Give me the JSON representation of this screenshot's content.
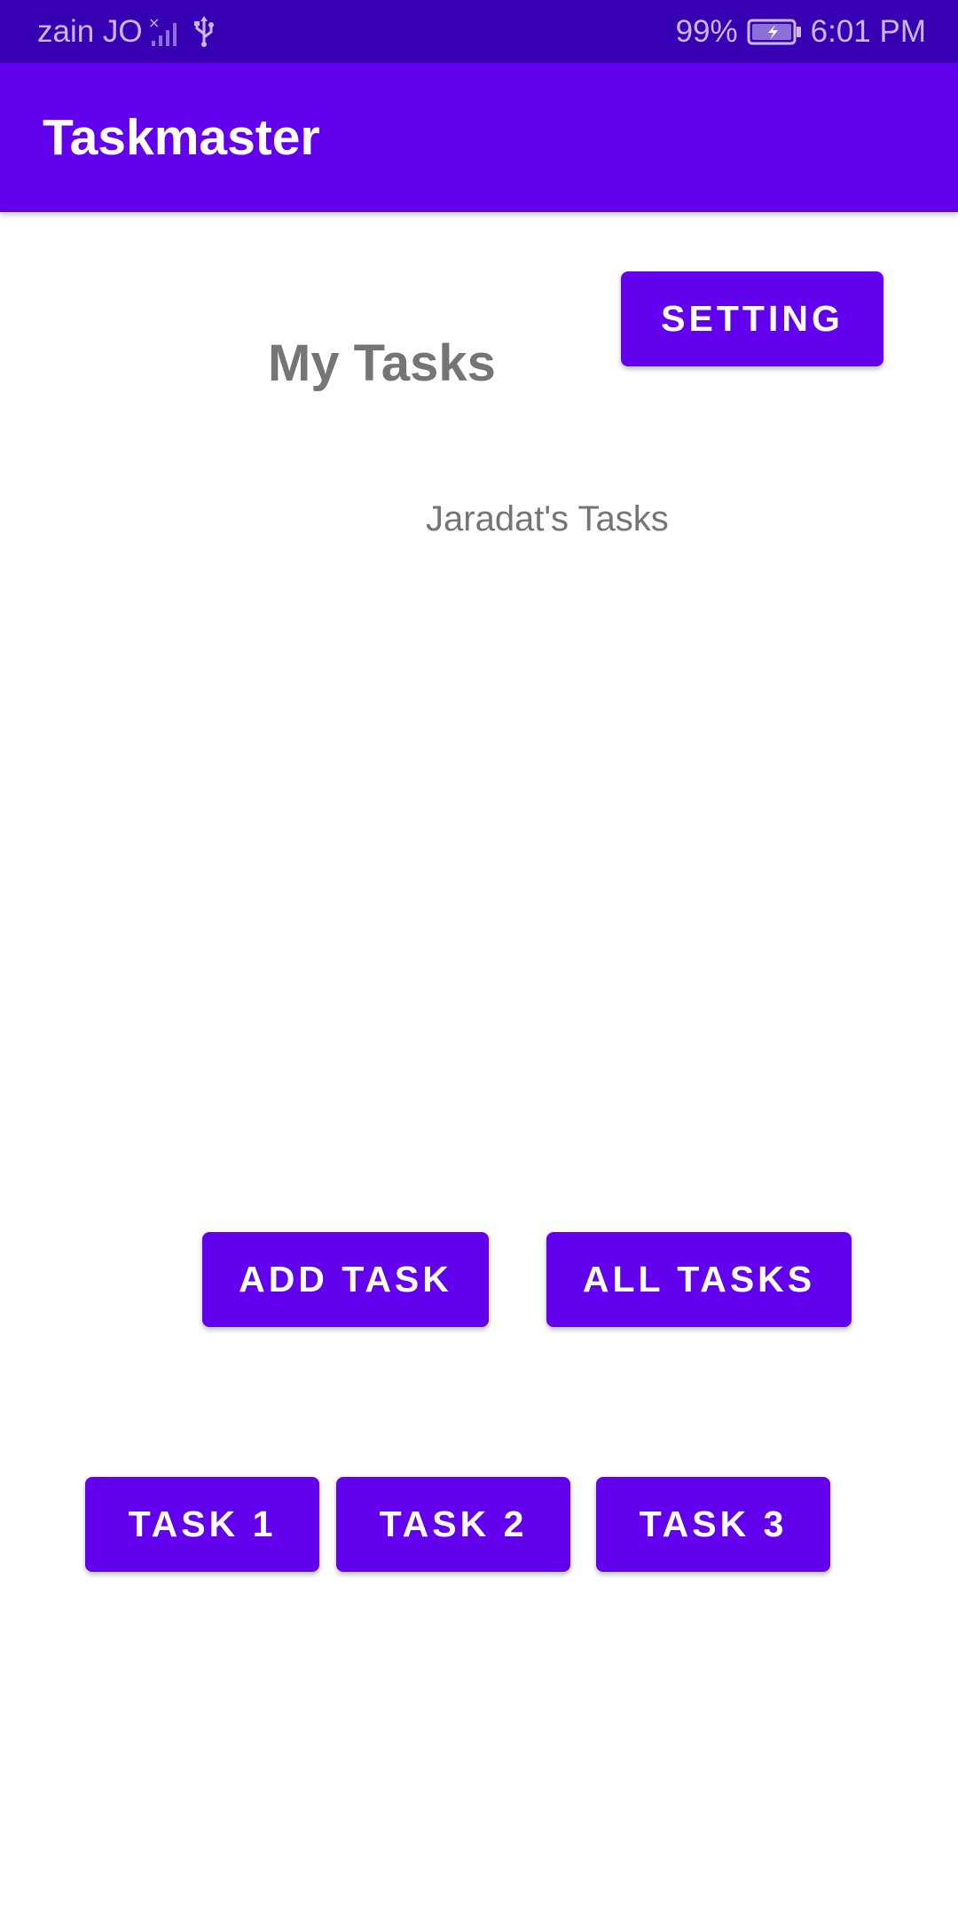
{
  "status_bar": {
    "carrier": "zain JO",
    "battery": "99%",
    "time": "6:01 PM",
    "icons": [
      "signal-icon",
      "usb-icon",
      "battery-icon"
    ]
  },
  "app_bar": {
    "title": "Taskmaster"
  },
  "main": {
    "setting_button": "SETTING",
    "heading": "My Tasks",
    "subheading": "Jaradat's Tasks",
    "add_task_button": "ADD TASK",
    "all_tasks_button": "ALL TASKS",
    "task_buttons": [
      "TASK 1",
      "TASK 2",
      "TASK 3"
    ]
  },
  "colors": {
    "status_bar": "#3700b3",
    "primary": "#6200ee",
    "button_text": "#ffffff",
    "text_gray": "#757575",
    "background": "#ffffff"
  }
}
